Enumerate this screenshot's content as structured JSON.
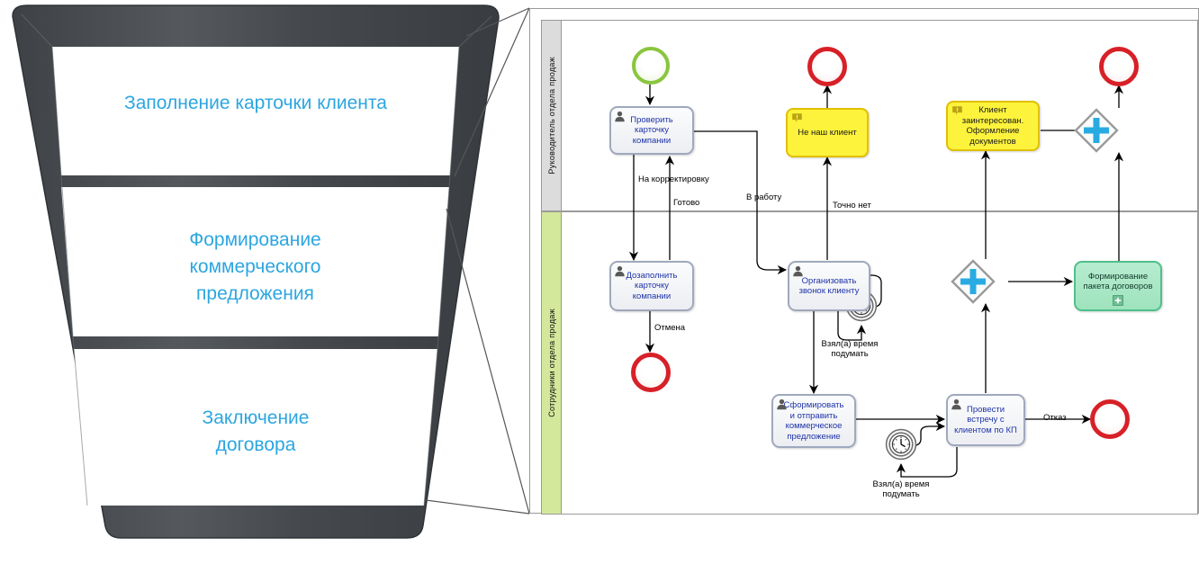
{
  "funnel": {
    "stages": [
      {
        "id": "stage-1",
        "label": "Заполнение карточки клиента"
      },
      {
        "id": "stage-2",
        "label": "Формирование\nкоммерческого\nпредложения"
      },
      {
        "id": "stage-3",
        "label": "Заключение\nдоговора"
      }
    ],
    "text_color": "#2ca6e0",
    "body_color": "#454b4f"
  },
  "diagram": {
    "lanes": [
      {
        "id": "lane-manager",
        "label": "Руководитель отдела продаж",
        "color": "#dcdcdc"
      },
      {
        "id": "lane-employees",
        "label": "Сотрудники отдела продаж",
        "color": "#d3e89a"
      }
    ],
    "tasks": [
      {
        "id": "task-check-card",
        "label": "Проверить\nкарточку\nкомпании",
        "icon": "user-icon"
      },
      {
        "id": "task-fill-card",
        "label": "Дозаполнить\nкарточку\nкомпании",
        "icon": "user-icon"
      },
      {
        "id": "task-call-client",
        "label": "Организовать\nзвонок клиенту",
        "icon": "user-icon"
      },
      {
        "id": "task-send-offer",
        "label": "Сформировать\nи отправить\nкоммерческое\nпредложение",
        "icon": "user-icon"
      },
      {
        "id": "task-meeting",
        "label": "Провести\nвстречу с\nклиентом по КП",
        "icon": "user-icon"
      }
    ],
    "annotations": [
      {
        "id": "annot-not-our-client",
        "label": "Не наш клиент",
        "icon": "note-icon",
        "color": "#fdf33c"
      },
      {
        "id": "annot-client-interested",
        "label": "Клиент\nзаинтересован.\nОформление\nдокументов",
        "icon": "note-icon",
        "color": "#fdf33c"
      }
    ],
    "subprocesses": [
      {
        "id": "subprocess-contract-package",
        "label": "Формирование\nпакета договоров",
        "marker": "plus-icon",
        "color": "#9ee3bd"
      }
    ],
    "events": [
      {
        "id": "event-start",
        "type": "start-event",
        "color": "#8ac53e"
      },
      {
        "id": "event-end-cancel",
        "type": "end-event",
        "color": "#d72027"
      },
      {
        "id": "event-end-not-ours",
        "type": "end-event",
        "color": "#d72027"
      },
      {
        "id": "event-end-refusal",
        "type": "end-event",
        "color": "#d72027"
      },
      {
        "id": "event-end-done",
        "type": "end-event",
        "color": "#d72027"
      },
      {
        "id": "event-timer-call",
        "type": "timer-boundary-event"
      },
      {
        "id": "event-timer-meeting",
        "type": "timer-boundary-event"
      }
    ],
    "gateways": [
      {
        "id": "gateway-parallel-join",
        "type": "parallel-gateway",
        "marker": "plus-icon",
        "color": "#29abe2"
      },
      {
        "id": "gateway-parallel-split",
        "type": "parallel-gateway",
        "marker": "plus-icon",
        "color": "#29abe2"
      }
    ],
    "flow_labels": [
      {
        "id": "flow-label-correction",
        "label": "На корректировку"
      },
      {
        "id": "flow-label-ready",
        "label": "Готово"
      },
      {
        "id": "flow-label-to-work",
        "label": "В работу"
      },
      {
        "id": "flow-label-definitely-no",
        "label": "Точно нет"
      },
      {
        "id": "flow-label-cancel",
        "label": "Отмена"
      },
      {
        "id": "flow-label-think-1",
        "label": "Взял(а)  время\nподумать"
      },
      {
        "id": "flow-label-think-2",
        "label": "Взял(а)  время\nподумать"
      },
      {
        "id": "flow-label-refusal",
        "label": "Отказ"
      }
    ]
  }
}
